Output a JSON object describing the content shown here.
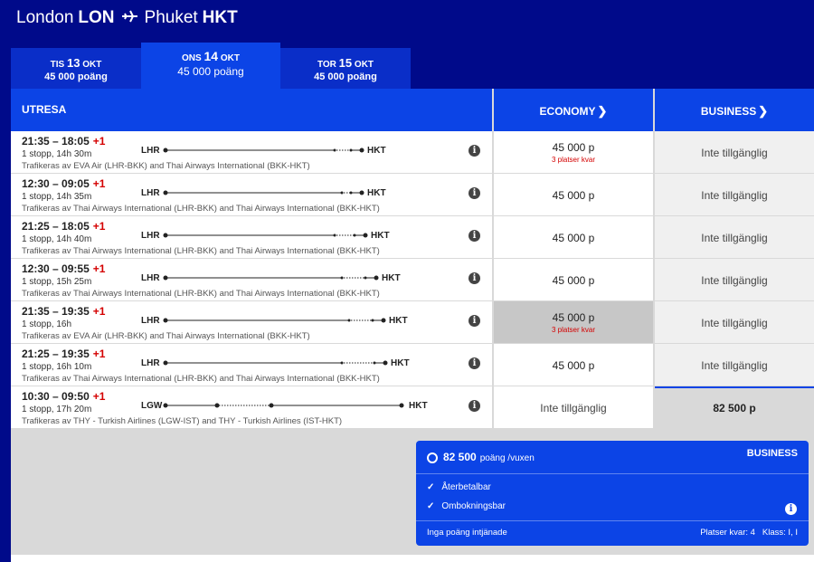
{
  "route": {
    "from_city": "London",
    "from_code": "LON",
    "to_city": "Phuket",
    "to_code": "HKT"
  },
  "tabs": [
    {
      "dow": "TIS",
      "num": "13",
      "month": "OKT",
      "points": "45 000 poäng",
      "active": false
    },
    {
      "dow": "ONS",
      "num": "14",
      "month": "OKT",
      "points": "45 000 poäng",
      "active": true
    },
    {
      "dow": "TOR",
      "num": "15",
      "month": "OKT",
      "points": "45 000 poäng",
      "active": false
    }
  ],
  "headers": {
    "outbound": "UTRESA",
    "economy": "ECONOMY",
    "business": "BUSINESS"
  },
  "flights": [
    {
      "dep": "21:35",
      "arr": "18:05",
      "plus": "+1",
      "stops": "1 stopp, 14h 30m",
      "from": "LHR",
      "to": "HKT",
      "ops": "Trafikeras av EVA Air (LHR-BKK) and Thai Airways International (BKK-HKT)",
      "eco": "45 000 p",
      "eco_seats": "3 platser kvar",
      "bus": "Inte tillgänglig"
    },
    {
      "dep": "12:30",
      "arr": "09:05",
      "plus": "+1",
      "stops": "1 stopp, 14h 35m",
      "from": "LHR",
      "to": "HKT",
      "ops": "Trafikeras av Thai Airways International (LHR-BKK) and Thai Airways International (BKK-HKT)",
      "eco": "45 000 p",
      "eco_seats": "",
      "bus": "Inte tillgänglig"
    },
    {
      "dep": "21:25",
      "arr": "18:05",
      "plus": "+1",
      "stops": "1 stopp, 14h 40m",
      "from": "LHR",
      "to": "HKT",
      "ops": "Trafikeras av Thai Airways International (LHR-BKK) and Thai Airways International (BKK-HKT)",
      "eco": "45 000 p",
      "eco_seats": "",
      "bus": "Inte tillgänglig"
    },
    {
      "dep": "12:30",
      "arr": "09:55",
      "plus": "+1",
      "stops": "1 stopp, 15h 25m",
      "from": "LHR",
      "to": "HKT",
      "ops": "Trafikeras av Thai Airways International (LHR-BKK) and Thai Airways International (BKK-HKT)",
      "eco": "45 000 p",
      "eco_seats": "",
      "bus": "Inte tillgänglig"
    },
    {
      "dep": "21:35",
      "arr": "19:35",
      "plus": "+1",
      "stops": "1 stopp, 16h",
      "from": "LHR",
      "to": "HKT",
      "ops": "Trafikeras av EVA Air (LHR-BKK) and Thai Airways International (BKK-HKT)",
      "eco": "45 000 p",
      "eco_seats": "3 platser kvar",
      "bus": "Inte tillgänglig"
    },
    {
      "dep": "21:25",
      "arr": "19:35",
      "plus": "+1",
      "stops": "1 stopp, 16h 10m",
      "from": "LHR",
      "to": "HKT",
      "ops": "Trafikeras av Thai Airways International (LHR-BKK) and Thai Airways International (BKK-HKT)",
      "eco": "45 000 p",
      "eco_seats": "",
      "bus": "Inte tillgänglig"
    },
    {
      "dep": "10:30",
      "arr": "09:50",
      "plus": "+1",
      "stops": "1 stopp, 17h 20m",
      "from": "LGW",
      "to": "HKT",
      "ops": "Trafikeras av THY - Turkish Airlines (LGW-IST) and THY - Turkish Airlines (IST-HKT)",
      "eco": "Inte tillgänglig",
      "eco_seats": "",
      "bus": "82 500 p"
    }
  ],
  "fare_popup": {
    "points": "82 500",
    "unit": "poäng /vuxen",
    "class_name": "BUSINESS",
    "features": [
      "Återbetalbar",
      "Ombokningsbar"
    ],
    "earn": "Inga poäng intjänade",
    "seats_left": "Platser kvar: 4",
    "booking_class": "Klass: I, I"
  },
  "colors": {
    "brand": "#000a8a",
    "accent": "#0c44e6",
    "tab": "#0a2ec8",
    "warning": "#d40000"
  }
}
